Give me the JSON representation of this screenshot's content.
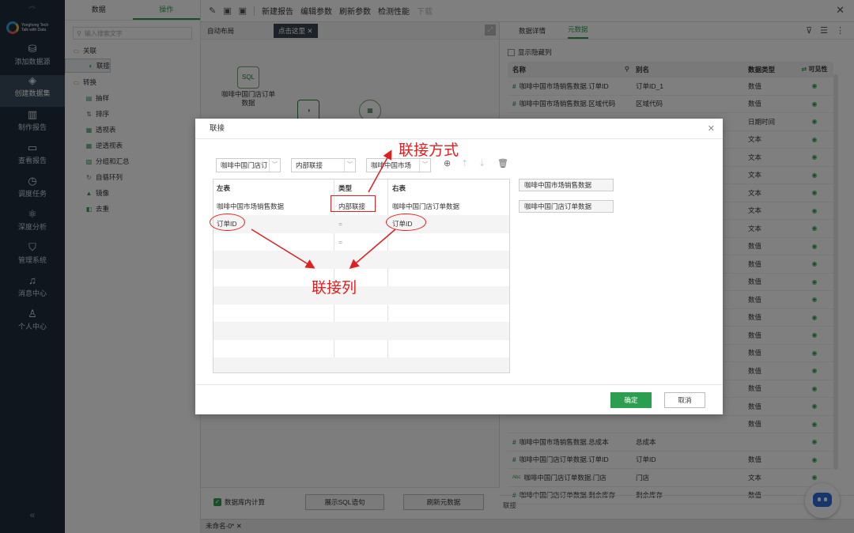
{
  "nav": {
    "logo_text": [
      "Yonghong Tech",
      "Talk with Data"
    ],
    "items": [
      {
        "label": "添加数据源",
        "icon": "database-icon"
      },
      {
        "label": "创建数据集",
        "icon": "layers-icon",
        "active": true
      },
      {
        "label": "制作报告",
        "icon": "chart-icon"
      },
      {
        "label": "查看报告",
        "icon": "monitor-icon"
      },
      {
        "label": "调度任务",
        "icon": "clock-icon"
      },
      {
        "label": "深度分析",
        "icon": "network-icon"
      },
      {
        "label": "管理系统",
        "icon": "shield-icon"
      },
      {
        "label": "消息中心",
        "icon": "bell-icon"
      },
      {
        "label": "个人中心",
        "icon": "user-icon"
      }
    ],
    "collapse": "«"
  },
  "tree": {
    "tabs": [
      "数据",
      "操作"
    ],
    "active_tab": "操作",
    "search_placeholder": "输入搜索文字",
    "items": [
      {
        "label": "关联",
        "level": 0,
        "icon": "folder-icon"
      },
      {
        "label": "联接",
        "level": 1,
        "icon": "join-icon",
        "selected": true
      },
      {
        "label": "联合",
        "level": 1,
        "icon": "union-icon"
      },
      {
        "label": "转换",
        "level": 0,
        "icon": "folder-icon"
      },
      {
        "label": "抽样",
        "level": 1,
        "icon": "sample-icon"
      },
      {
        "label": "排序",
        "level": 1,
        "icon": "sort-icon"
      },
      {
        "label": "透视表",
        "level": 1,
        "icon": "pivot-icon"
      },
      {
        "label": "逆透视表",
        "level": 1,
        "icon": "unpivot-icon"
      },
      {
        "label": "分组和汇总",
        "level": 1,
        "icon": "group-icon"
      },
      {
        "label": "自循环列",
        "level": 1,
        "icon": "loop-icon"
      },
      {
        "label": "镜像",
        "level": 1,
        "icon": "mirror-icon"
      },
      {
        "label": "去重",
        "level": 1,
        "icon": "dedupe-icon"
      }
    ]
  },
  "toolbar": {
    "items": [
      "新建报告",
      "编辑参数",
      "刷新参数",
      "检测性能",
      "下载"
    ],
    "close": "✕"
  },
  "canvas": {
    "auto_layout": "自动布局",
    "hint": "点击这里",
    "node1_tag": "SQL",
    "node1_label": "咖啡中国门店订单数据",
    "db_calc": "数据库内计算",
    "show_sql": "展示SQL语句",
    "refresh_meta": "刷新元数据"
  },
  "doc_tab": "未命名-0*",
  "right": {
    "tabs": [
      "数据详情",
      "元数据"
    ],
    "active_tab": "元数据",
    "show_hidden": "显示隐藏列",
    "columns": [
      "名称",
      "别名",
      "数据类型",
      "可见性"
    ],
    "rows": [
      {
        "name": "咖啡中国市场销售数据.订单ID",
        "alias": "订单ID_1",
        "type": "数值",
        "kind": "#"
      },
      {
        "name": "咖啡中国市场销售数据.区域代码",
        "alias": "区域代码",
        "type": "数值",
        "kind": "#"
      },
      {
        "name": "",
        "alias": "",
        "type": "日期时间",
        "kind": ""
      },
      {
        "name": "",
        "alias": "",
        "type": "文本",
        "kind": ""
      },
      {
        "name": "",
        "alias": "",
        "type": "文本",
        "kind": ""
      },
      {
        "name": "",
        "alias": "",
        "type": "文本",
        "kind": ""
      },
      {
        "name": "",
        "alias": "",
        "type": "文本",
        "kind": ""
      },
      {
        "name": "",
        "alias": "",
        "type": "文本",
        "kind": ""
      },
      {
        "name": "",
        "alias": "",
        "type": "文本",
        "kind": ""
      },
      {
        "name": "",
        "alias": "",
        "type": "数值",
        "kind": ""
      },
      {
        "name": "",
        "alias": "",
        "type": "数值",
        "kind": ""
      },
      {
        "name": "",
        "alias": "",
        "type": "数值",
        "kind": ""
      },
      {
        "name": "",
        "alias": "",
        "type": "数值",
        "kind": ""
      },
      {
        "name": "",
        "alias": "",
        "type": "数值",
        "kind": ""
      },
      {
        "name": "",
        "alias": "",
        "type": "数值",
        "kind": ""
      },
      {
        "name": "",
        "alias": "",
        "type": "数值",
        "kind": ""
      },
      {
        "name": "",
        "alias": "",
        "type": "数值",
        "kind": ""
      },
      {
        "name": "",
        "alias": "",
        "type": "数值",
        "kind": ""
      },
      {
        "name": "",
        "alias": "",
        "type": "数值",
        "kind": ""
      },
      {
        "name": "",
        "alias": "",
        "type": "数值",
        "kind": ""
      },
      {
        "name": "咖啡中国市场销售数据.总成本",
        "alias": "总成本",
        "type": "",
        "kind": "#"
      },
      {
        "name": "咖啡中国门店订单数据.订单ID",
        "alias": "订单ID",
        "type": "数值",
        "kind": "#"
      },
      {
        "name": "咖啡中国门店订单数据.门店",
        "alias": "门店",
        "type": "文本",
        "kind": "Abc"
      },
      {
        "name": "咖啡中国门店订单数据.剩余库存",
        "alias": "剩余库存",
        "type": "数值",
        "kind": "#"
      }
    ],
    "footer": "联接"
  },
  "modal": {
    "title": "联接",
    "left_select": "咖啡中国门店订",
    "join_select": "内部联接",
    "right_select": "咖啡中国市场",
    "table_headers": [
      "左表",
      "类型",
      "右表"
    ],
    "rows": [
      {
        "left": "咖啡中国市场销售数据",
        "type": "内部联接",
        "right": "咖啡中国门店订单数据"
      },
      {
        "left": "订单ID",
        "type": "=",
        "right": "订单ID"
      },
      {
        "left": "",
        "type": "=",
        "right": ""
      }
    ],
    "table_buttons": [
      "咖啡中国市场销售数据",
      "咖啡中国门店订单数据"
    ],
    "ok": "确定",
    "cancel": "取消"
  },
  "annotations": {
    "join_method": "联接方式",
    "join_column": "联接列"
  },
  "colors": {
    "accent": "#2c9e4f",
    "nav_bg": "#1f2d3d",
    "annotation": "#e02020"
  }
}
